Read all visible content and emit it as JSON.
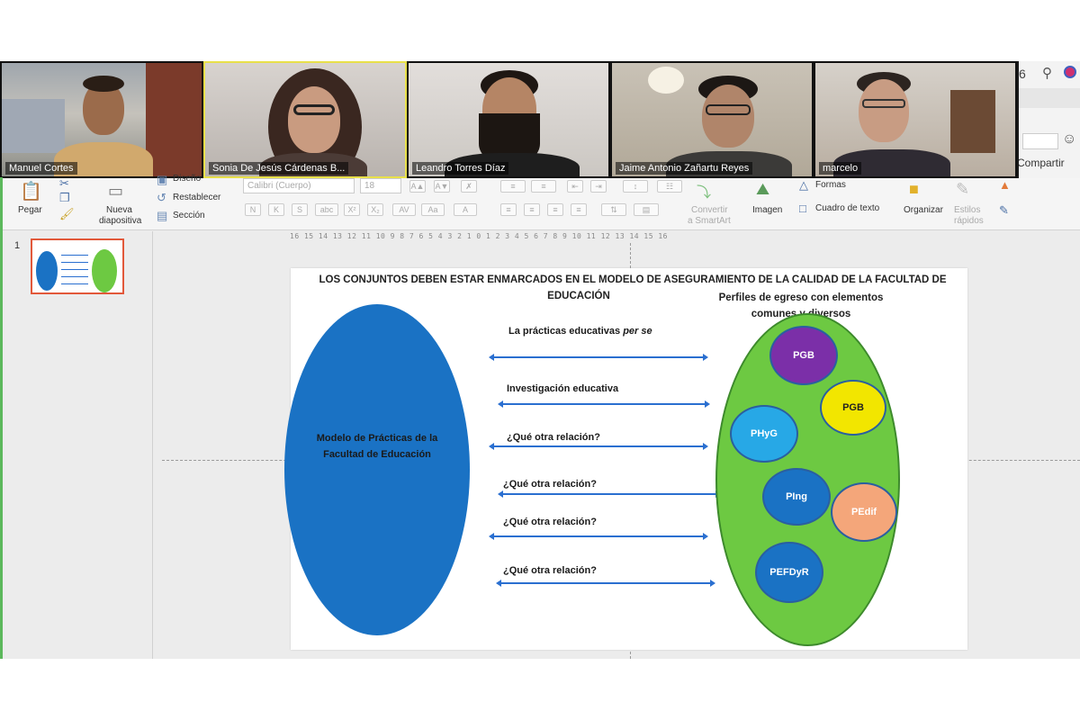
{
  "participants": [
    {
      "name": "Manuel Cortes"
    },
    {
      "name": "Sonia De Jesús Cárdenas B..."
    },
    {
      "name": "Leandro Torres Díaz"
    },
    {
      "name": "Jaime Antonio Zañartu Reyes"
    },
    {
      "name": "marcelo"
    }
  ],
  "browser": {
    "counter": "6",
    "share_label": "Compartir"
  },
  "ribbon": {
    "paste": "Pegar",
    "new_slide_1": "Nueva",
    "new_slide_2": "diapositiva",
    "design": "Diseño",
    "reset": "Restablecer",
    "section": "Sección",
    "font_name": "Calibri (Cuerpo)",
    "font_size": "18",
    "convert_1": "Convertir",
    "convert_2": "a SmartArt",
    "image": "Imagen",
    "shapes": "Formas",
    "textbox": "Cuadro de texto",
    "organize": "Organizar",
    "styles_1": "Estilos",
    "styles_2": "rápidos"
  },
  "thumbnail": {
    "number": "1"
  },
  "ruler": {
    "labels": "16 15 14 13 12 11 10 9 8 7 6 5 4 3 2 1 0 1 2 3 4 5 6 7 8 9 10 11 12 13 14 15 16"
  },
  "slide": {
    "title_line1": "LOS CONJUNTOS DEBEN ESTAR ENMARCADOS EN EL MODELO DE ASEGURAMIENTO DE LA CALIDAD DE LA FACULTAD DE",
    "title_line2": "EDUCACIÓN",
    "profiles_line1": "Perfiles de egreso con elementos",
    "profiles_line2": "comunes y diversos",
    "model_line1": "Modelo de Prácticas de la",
    "model_line2": "Facultad de Educación",
    "relations": [
      {
        "text": "La prácticas educativas ",
        "emph": "per se"
      },
      {
        "text": "Investigación educativa"
      },
      {
        "text": "¿Qué otra relación?"
      },
      {
        "text": "¿Qué otra relación?"
      },
      {
        "text": "¿Qué otra relación?"
      },
      {
        "text": "¿Qué otra relación?"
      }
    ],
    "profiles": [
      {
        "label": "PGB",
        "color": "#7b2fa8"
      },
      {
        "label": "PGB",
        "color": "#f2e600",
        "text_color": "#222222"
      },
      {
        "label": "PHyG",
        "color": "#27a8e6"
      },
      {
        "label": "PIng",
        "color": "#1a72c4"
      },
      {
        "label": "PEdif",
        "color": "#f4a67a"
      },
      {
        "label": "PEFDyR",
        "color": "#1a72c4"
      }
    ],
    "colors": {
      "model_oval": "#1a72c4",
      "profiles_oval": "#6dc942",
      "arrow": "#2a6fd0"
    }
  }
}
